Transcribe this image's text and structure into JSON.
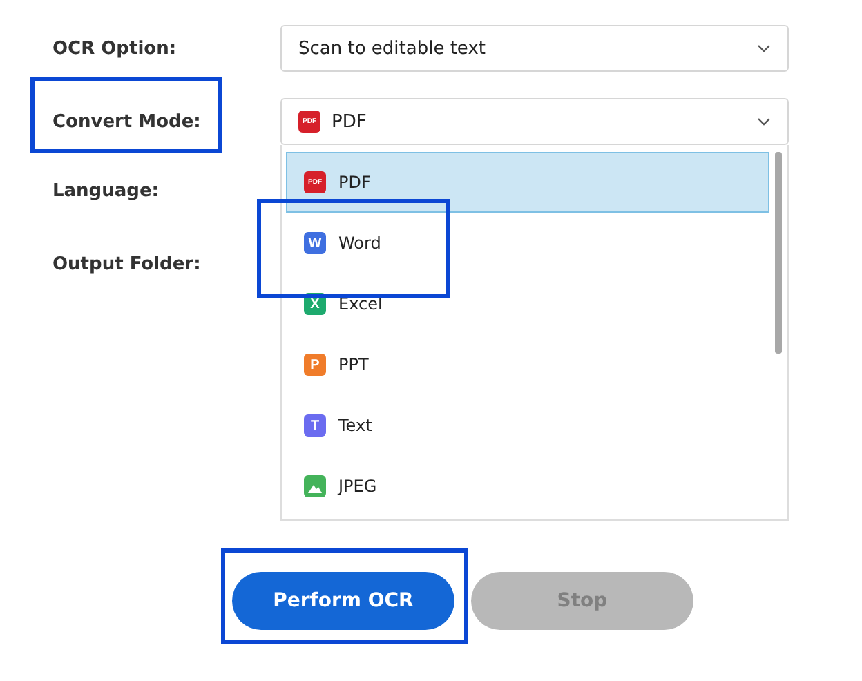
{
  "fields": [
    {
      "label": "OCR Option:",
      "value": "Scan to editable text",
      "kind": "select"
    },
    {
      "label": "Convert Mode:",
      "value": "PDF",
      "icon": {
        "kind": "pdf",
        "badge": "PDF"
      },
      "kind": "select",
      "expanded": true
    },
    {
      "label": "Language:"
    },
    {
      "label": "Output Folder:"
    }
  ],
  "dropdown_options": [
    {
      "label": "PDF",
      "kind": "pdf",
      "badge": "PDF",
      "selected": true
    },
    {
      "label": "Word",
      "kind": "word",
      "badge": "W",
      "selected": false
    },
    {
      "label": "Excel",
      "kind": "excel",
      "badge": "X",
      "selected": false
    },
    {
      "label": "PPT",
      "kind": "ppt",
      "badge": "P",
      "selected": false
    },
    {
      "label": "Text",
      "kind": "text",
      "badge": "T",
      "selected": false
    },
    {
      "label": "JPEG",
      "kind": "image",
      "selected": false
    }
  ],
  "buttons": [
    {
      "label": "Perform OCR",
      "disabled": false
    },
    {
      "label": "Stop",
      "disabled": true
    }
  ]
}
